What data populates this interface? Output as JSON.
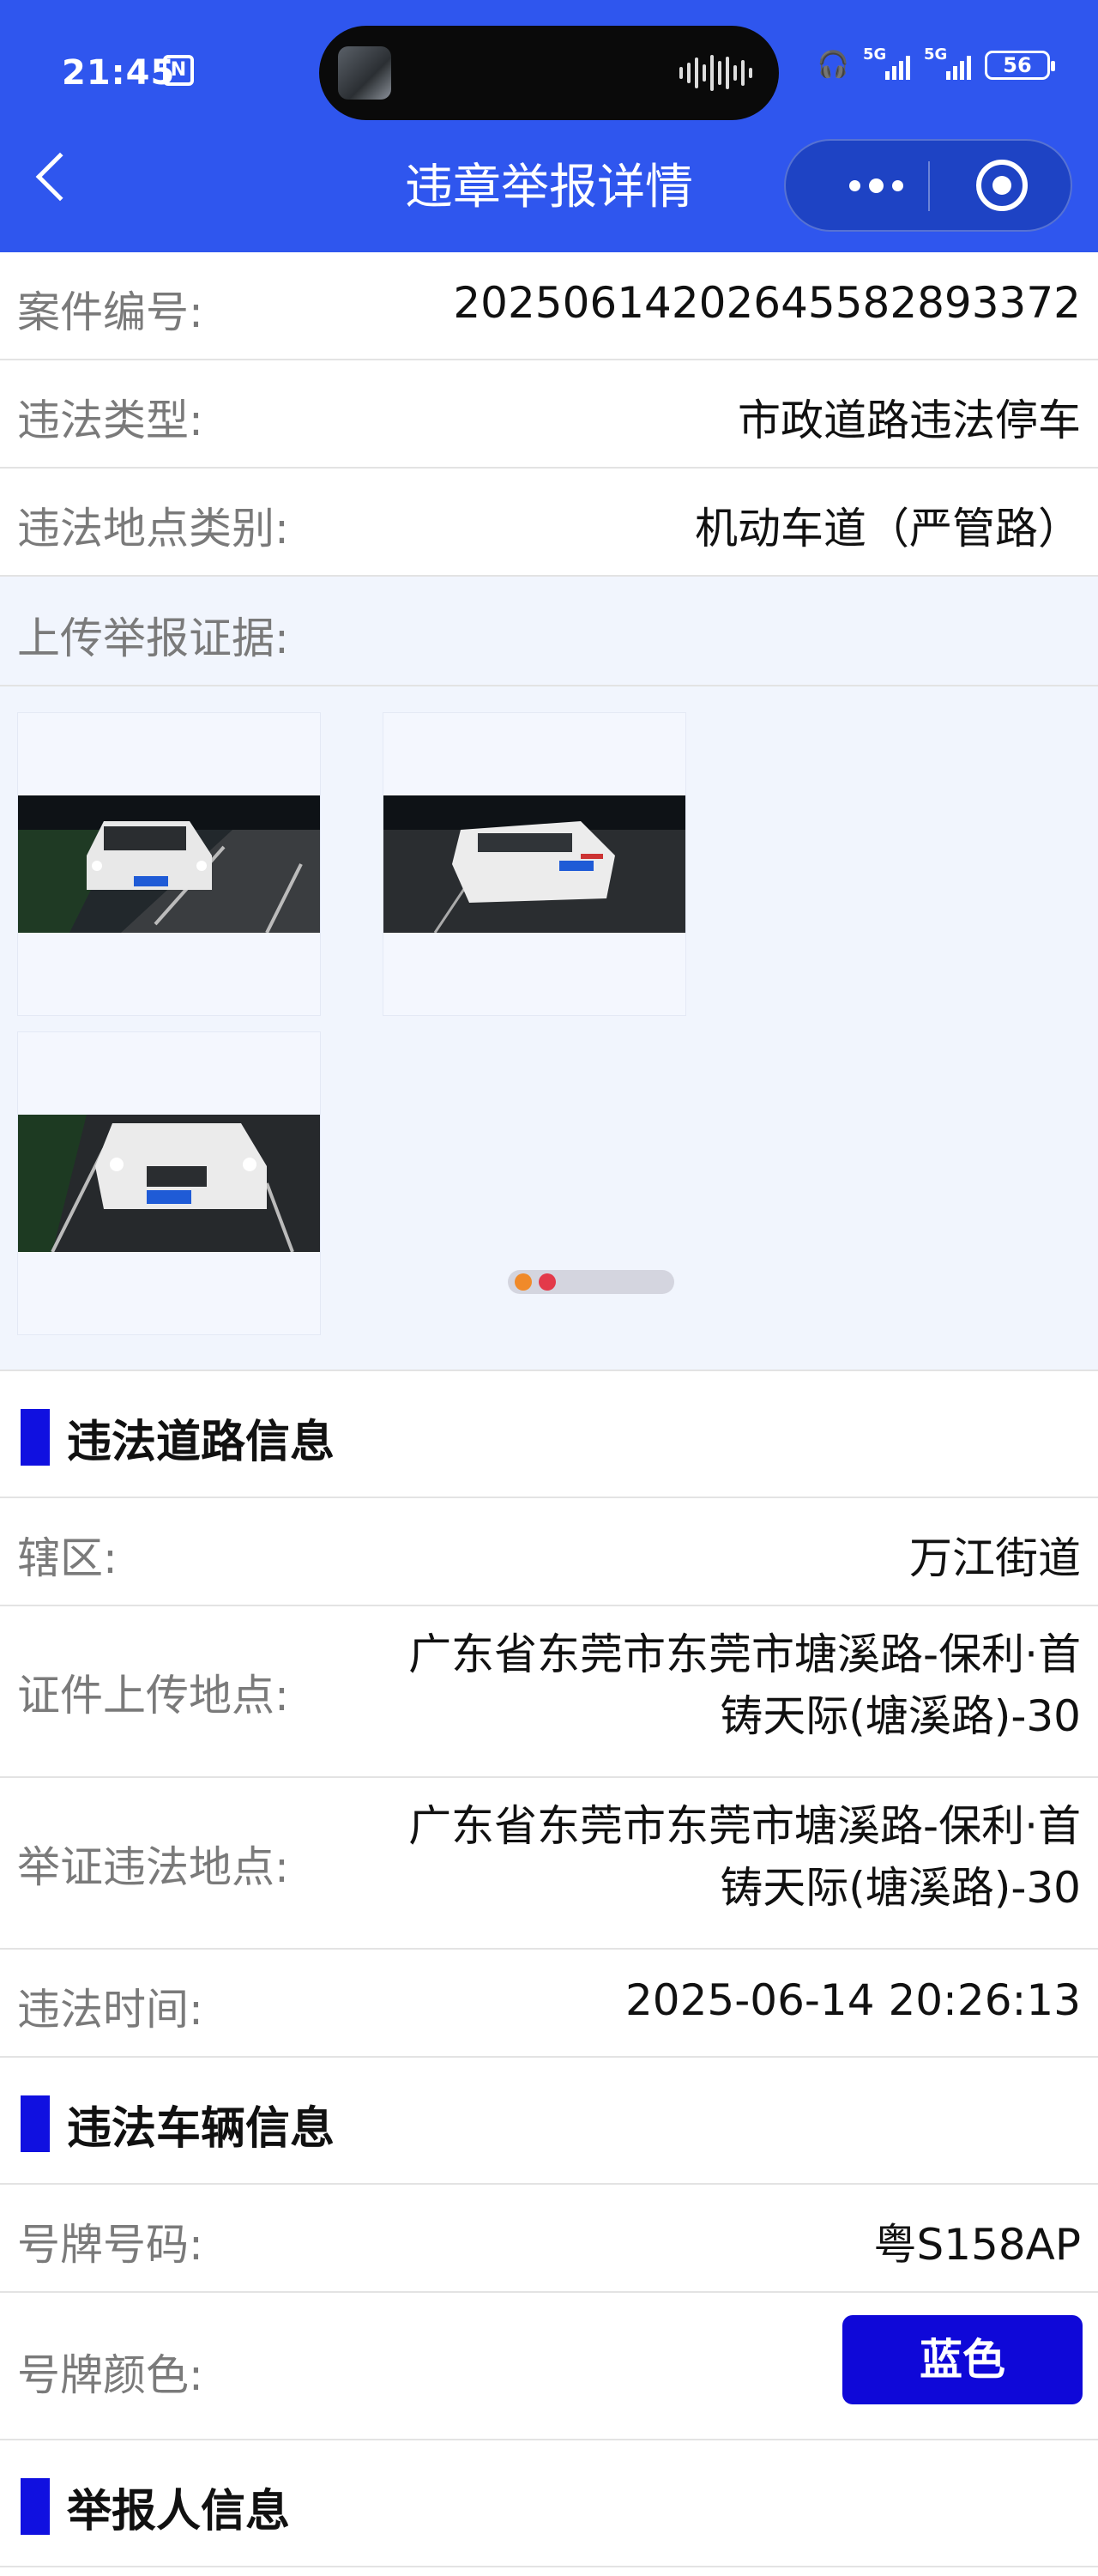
{
  "status_bar": {
    "time": "21:45",
    "nfc": "N",
    "network1": "5G",
    "network2": "5G",
    "battery": "56"
  },
  "nav": {
    "title": "违章举报详情"
  },
  "case": {
    "case_number_label": "案件编号:",
    "case_number": "20250614202645582893372",
    "violation_type_label": "违法类型:",
    "violation_type": "市政道路违法停车",
    "location_category_label": "违法地点类别:",
    "location_category": "机动车道（严管路）",
    "evidence_label": "上传举报证据:"
  },
  "road_section": {
    "title": "违法道路信息",
    "district_label": "辖区:",
    "district": "万江街道",
    "upload_location_label": "证件上传地点:",
    "upload_location": "广东省东莞市东莞市塘溪路-保利·首铸天际(塘溪路)-30",
    "evidence_location_label": "举证违法地点:",
    "evidence_location": "广东省东莞市东莞市塘溪路-保利·首铸天际(塘溪路)-30",
    "time_label": "违法时间:",
    "time": "2025-06-14 20:26:13"
  },
  "vehicle_section": {
    "title": "违法车辆信息",
    "plate_label": "号牌号码:",
    "plate": "粤S158AP",
    "plate_color_label": "号牌颜色:",
    "plate_color": "蓝色"
  },
  "reporter_section": {
    "title": "举报人信息"
  },
  "colors": {
    "header": "#2f56ee",
    "accent": "#1010e0",
    "pill": "#0f08d8"
  }
}
